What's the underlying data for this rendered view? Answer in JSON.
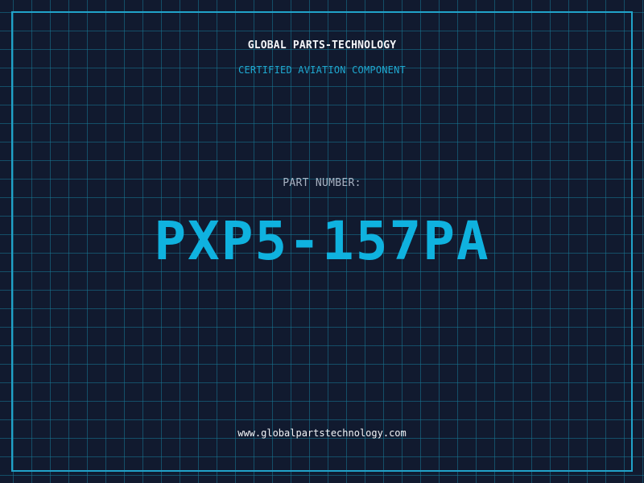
{
  "header": {
    "brand": "GLOBAL PARTS-TECHNOLOGY",
    "subtitle": "CERTIFIED AVIATION COMPONENT"
  },
  "part": {
    "label": "PART NUMBER:",
    "number": "PXP5-157PA"
  },
  "footer": {
    "website": "www.globalpartstechnology.com"
  },
  "colors": {
    "background": "#111a2f",
    "grid": "#177896",
    "frame": "#21a3c9",
    "accent": "#0fb2df",
    "text": "#f3f5f8",
    "muted": "#a9b2c2"
  }
}
